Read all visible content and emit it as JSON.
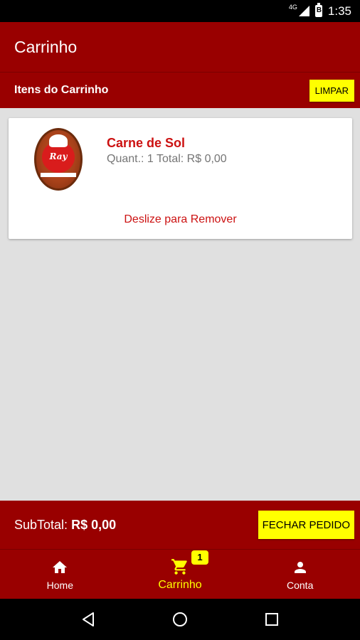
{
  "status_bar": {
    "network": "4G",
    "battery_label": "B",
    "time": "1:35"
  },
  "app_bar": {
    "title": "Carrinho"
  },
  "cart_header": {
    "title": "Itens do Carrinho",
    "clear_label": "LIMPAR"
  },
  "cart_items": [
    {
      "name": "Carne de Sol",
      "detail": "Quant.: 1 Total: R$ 0,00",
      "logo_text": "Ray",
      "swipe_hint": "Deslize para Remover"
    }
  ],
  "footer": {
    "subtotal_label": "SubTotal:",
    "subtotal_value": "R$ 0,00",
    "checkout_label": "FECHAR PEDIDO"
  },
  "bottom_nav": {
    "items": [
      {
        "label": "Home",
        "icon": "home-icon"
      },
      {
        "label": "Carrinho",
        "icon": "cart-icon",
        "badge": "1",
        "active": true
      },
      {
        "label": "Conta",
        "icon": "person-icon"
      }
    ]
  },
  "colors": {
    "primary": "#990000",
    "accent": "#ffff00",
    "item_title": "#cc1111",
    "background": "#e0e0e0"
  }
}
